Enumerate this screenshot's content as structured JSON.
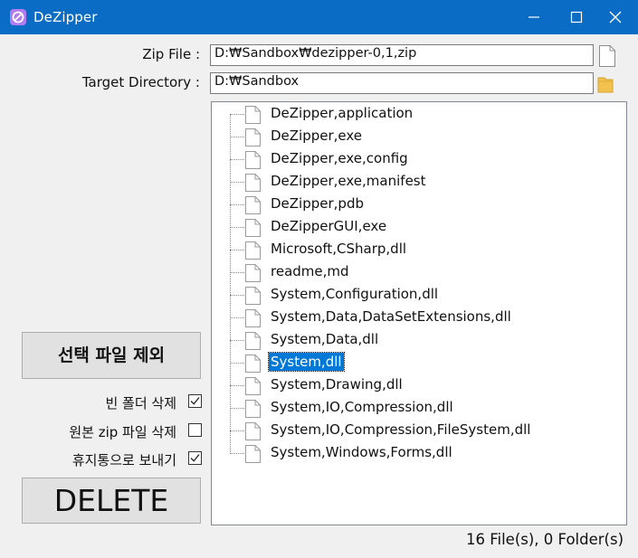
{
  "window": {
    "title": "DeZipper"
  },
  "form": {
    "zip_label": "Zip File :",
    "zip_value": "D:₩Sandbox₩dezipper-0,1,zip",
    "target_label": "Target Directory :",
    "target_value": "D:₩Sandbox"
  },
  "tree": {
    "items": [
      "DeZipper,application",
      "DeZipper,exe",
      "DeZipper,exe,config",
      "DeZipper,exe,manifest",
      "DeZipper,pdb",
      "DeZipperGUI,exe",
      "Microsoft,CSharp,dll",
      "readme,md",
      "System,Configuration,dll",
      "System,Data,DataSetExtensions,dll",
      "System,Data,dll",
      "System,dll",
      "System,Drawing,dll",
      "System,IO,Compression,dll",
      "System,IO,Compression,FileSystem,dll",
      "System,Windows,Forms,dll"
    ],
    "selected_index": 11
  },
  "actions": {
    "exclude_label": "선택 파일 제외",
    "delete_label": "DELETE"
  },
  "options": {
    "delete_empty_folders": {
      "label": "빈 폴더 삭제",
      "checked": true
    },
    "delete_source_zip": {
      "label": "원본 zip 파일 삭제",
      "checked": false
    },
    "send_to_recycle_bin": {
      "label": "휴지통으로 보내기",
      "checked": true
    }
  },
  "status": {
    "text": "16 File(s), 0 Folder(s)"
  },
  "colors": {
    "titlebar": "#0a6cc4",
    "selection": "#0078d7",
    "folder": "#f2c14e"
  },
  "icons": {
    "app": "dezipper-app-icon",
    "file": "document-icon",
    "folder": "folder-icon"
  }
}
